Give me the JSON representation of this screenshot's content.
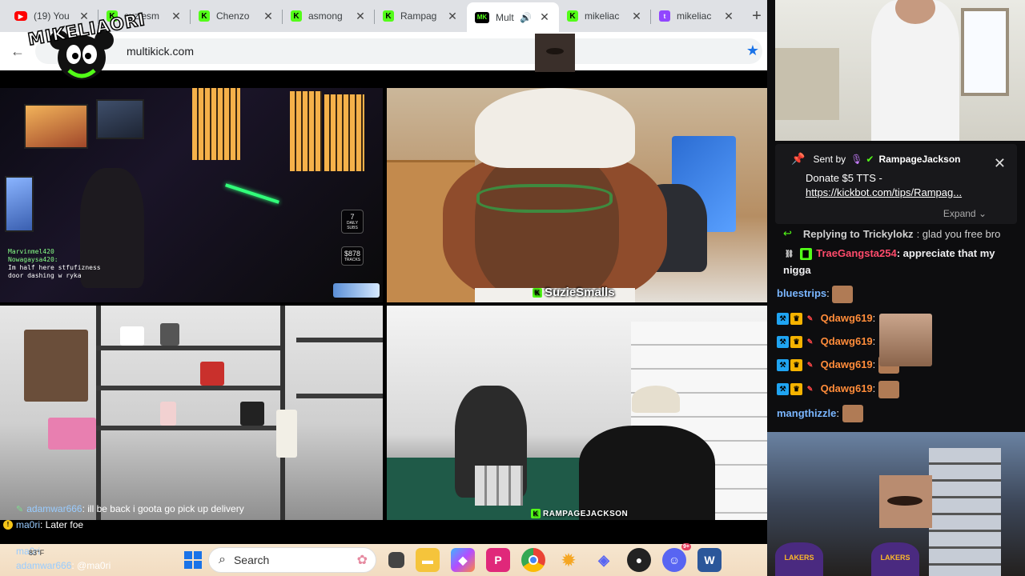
{
  "browser": {
    "tabs": [
      {
        "title": "(19) You",
        "favicon": "youtube",
        "active": false
      },
      {
        "title": "suziesm",
        "favicon": "kick",
        "active": false
      },
      {
        "title": "Chenzo",
        "favicon": "kick",
        "active": false
      },
      {
        "title": "asmong",
        "favicon": "kick",
        "active": false
      },
      {
        "title": "Rampag",
        "favicon": "kick",
        "active": false
      },
      {
        "title": "Mult",
        "favicon": "multikick",
        "active": true
      },
      {
        "title": "mikeliac",
        "favicon": "kick",
        "active": false
      },
      {
        "title": "mikeliac",
        "favicon": "twitch",
        "active": false
      }
    ],
    "url": "multikick.com",
    "new_tab_glyph": "+",
    "close_glyph": "✕",
    "back_glyph": "←",
    "bookmark_glyph": "★"
  },
  "overlay_logo": {
    "text": "MIKELIAORI"
  },
  "tiles": {
    "t1": {
      "stats": [
        "7",
        "$878"
      ],
      "stat_labels": [
        "DAILY SUBS",
        "TRACKS"
      ],
      "mini_chat": [
        "Marvinmel420",
        "Nowagaysa420:",
        "Im half here stfufizness",
        "door dashing w ryka"
      ]
    },
    "t2": {
      "streamer_name": "SuzieSmalls"
    },
    "t3": {},
    "t4": {
      "streamer_name": "RAMPAGEJACKSON"
    }
  },
  "overlay_chat": [
    {
      "user": "adamwar666",
      "text": ": ill be back i goota go pick up delivery"
    },
    {
      "user": "ma0ri",
      "text": ": Later foe"
    }
  ],
  "taskbar": {
    "search_placeholder": "Search",
    "chat_lines": [
      {
        "user": "ma0ri",
        "text": ""
      },
      {
        "user": "adamwar666",
        "text": ": @ma0ri"
      }
    ],
    "temp": "83°F",
    "discord_badge": "9+",
    "app_icons": [
      "file-explorer-icon",
      "copilot-icon",
      "picsart-icon",
      "chrome-icon",
      "settings-icon",
      "kick-app-icon",
      "obs-icon",
      "discord-icon",
      "word-icon"
    ]
  },
  "alert": {
    "sent_by_label": "Sent by",
    "username": "RampageJackson",
    "message": "Donate $5 TTS -",
    "link": "https://kickbot.com/tips/Rampag...",
    "expand_label": "Expand",
    "close_glyph": "✕"
  },
  "chat": {
    "reply": {
      "prefix": "Replying to",
      "user": "Trickylokz",
      "text": ": glad you free bro"
    },
    "messages": [
      {
        "user": "TraeGangsta254",
        "text": ": appreciate that my nigga",
        "color": "#ff4b6b"
      },
      {
        "user": "bluestrips",
        "text": ":",
        "color": "#7ab6ff"
      },
      {
        "user": "Qdawg619",
        "text": ":",
        "color": "#ff8c3a"
      },
      {
        "user": "Qdawg619",
        "text": ":",
        "color": "#ff8c3a"
      },
      {
        "user": "Qdawg619",
        "text": ":",
        "color": "#ff8c3a"
      },
      {
        "user": "Qdawg619",
        "text": ":",
        "color": "#ff8c3a"
      },
      {
        "user": "mangthizzle",
        "text": ":",
        "color": "#7ab6ff"
      }
    ]
  },
  "webcam_bottom": {
    "caps": [
      "LAKERS",
      "LAKERS"
    ]
  }
}
